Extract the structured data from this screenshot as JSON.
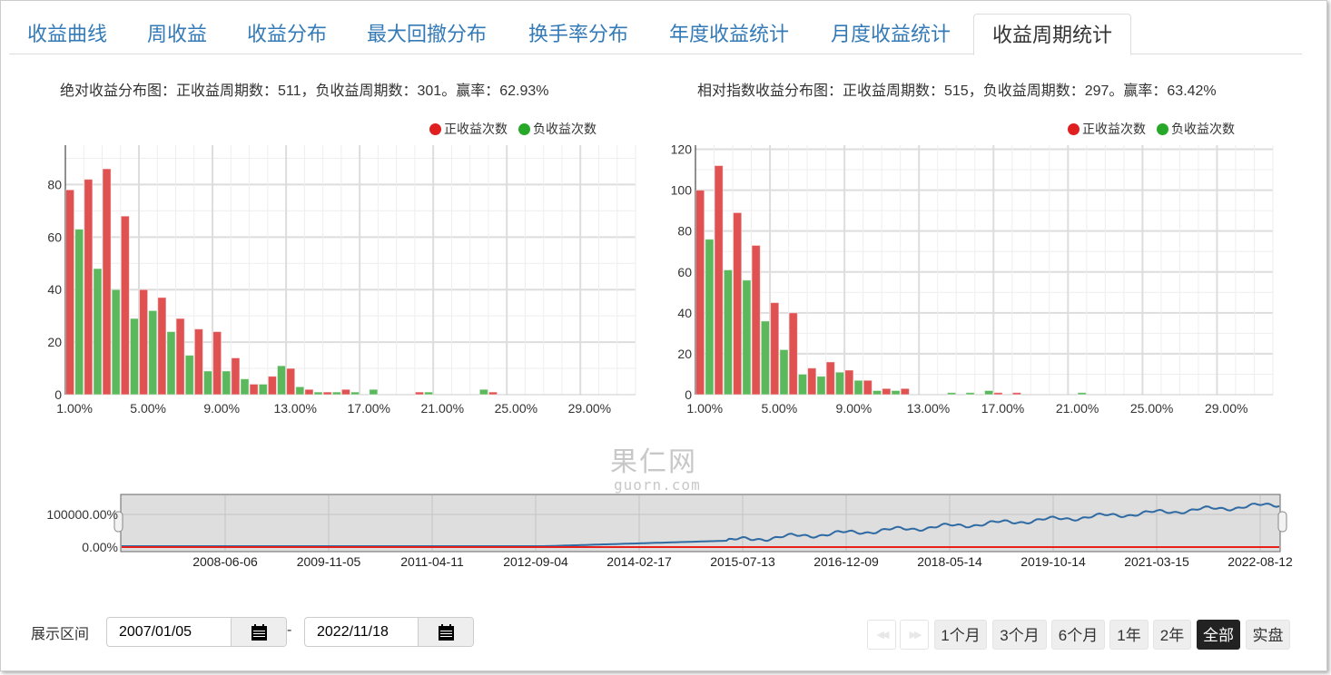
{
  "tabs": [
    {
      "label": "收益曲线"
    },
    {
      "label": "周收益"
    },
    {
      "label": "收益分布"
    },
    {
      "label": "最大回撤分布"
    },
    {
      "label": "换手率分布"
    },
    {
      "label": "年度收益统计"
    },
    {
      "label": "月度收益统计"
    },
    {
      "label": "收益周期统计",
      "active": true
    }
  ],
  "legend": {
    "positive": "正收益次数",
    "negative": "负收益次数"
  },
  "colors": {
    "positive": "#e05252",
    "negative": "#5cb85c",
    "accent": "#337ab7",
    "line_blue": "#2f6aa3",
    "line_red": "#e8201c"
  },
  "chart_data": [
    {
      "type": "bar",
      "title": "绝对收益分布图：正收益周期数：511，负收益周期数：301。赢率：62.93%",
      "categories": [
        "1.00%",
        "2.00%",
        "3.00%",
        "4.00%",
        "5.00%",
        "6.00%",
        "7.00%",
        "8.00%",
        "9.00%",
        "10.00%",
        "11.00%",
        "12.00%",
        "13.00%",
        "14.00%",
        "15.00%",
        "16.00%",
        "17.00%",
        "18.00%",
        "19.00%",
        "20.00%",
        "21.00%",
        "22.00%",
        "23.00%",
        "24.00%",
        "25.00%",
        "26.00%",
        "27.00%",
        "28.00%",
        "29.00%",
        "30.00%",
        "31.00%"
      ],
      "x_tick_labels": [
        "1.00%",
        "5.00%",
        "9.00%",
        "13.00%",
        "17.00%",
        "21.00%",
        "25.00%",
        "29.00%"
      ],
      "y_ticks": [
        0,
        20,
        40,
        60,
        80
      ],
      "ylim": [
        0,
        95
      ],
      "series": [
        {
          "name": "正收益次数",
          "values": [
            78,
            82,
            86,
            68,
            40,
            37,
            29,
            25,
            24,
            14,
            4,
            7,
            10,
            2,
            1,
            2,
            0,
            0,
            0,
            1,
            0,
            0,
            0,
            1,
            0,
            0,
            0,
            0,
            0,
            0,
            0
          ]
        },
        {
          "name": "负收益次数",
          "values": [
            63,
            48,
            40,
            29,
            32,
            24,
            15,
            9,
            9,
            6,
            4,
            11,
            3,
            1,
            1,
            1,
            2,
            0,
            0,
            1,
            0,
            0,
            2,
            0,
            0,
            0,
            0,
            0,
            0,
            0,
            0
          ]
        }
      ]
    },
    {
      "type": "bar",
      "title": "相对指数收益分布图：正收益周期数：515，负收益周期数：297。赢率：63.42%",
      "categories": [
        "1.00%",
        "2.00%",
        "3.00%",
        "4.00%",
        "5.00%",
        "6.00%",
        "7.00%",
        "8.00%",
        "9.00%",
        "10.00%",
        "11.00%",
        "12.00%",
        "13.00%",
        "14.00%",
        "15.00%",
        "16.00%",
        "17.00%",
        "18.00%",
        "19.00%",
        "20.00%",
        "21.00%",
        "22.00%",
        "23.00%",
        "24.00%",
        "25.00%",
        "26.00%",
        "27.00%",
        "28.00%",
        "29.00%",
        "30.00%",
        "31.00%"
      ],
      "x_tick_labels": [
        "1.00%",
        "5.00%",
        "9.00%",
        "13.00%",
        "17.00%",
        "21.00%",
        "25.00%",
        "29.00%"
      ],
      "y_ticks": [
        0,
        20,
        40,
        60,
        80,
        100,
        120
      ],
      "ylim": [
        0,
        122
      ],
      "series": [
        {
          "name": "正收益次数",
          "values": [
            100,
            112,
            89,
            73,
            45,
            40,
            13,
            16,
            12,
            7,
            3,
            3,
            0,
            0,
            0,
            0,
            1,
            1,
            0,
            0,
            0,
            0,
            0,
            0,
            0,
            0,
            0,
            0,
            0,
            0,
            0
          ]
        },
        {
          "name": "负收益次数",
          "values": [
            76,
            61,
            56,
            36,
            22,
            10,
            9,
            11,
            7,
            2,
            2,
            0,
            0,
            1,
            1,
            2,
            0,
            0,
            0,
            0,
            1,
            0,
            0,
            0,
            0,
            0,
            0,
            0,
            0,
            0,
            0
          ]
        }
      ]
    }
  ],
  "navigator": {
    "y_labels": [
      "100000.00%",
      "0.00%"
    ],
    "x_labels": [
      "2008-06-06",
      "2009-11-05",
      "2011-04-11",
      "2012-09-04",
      "2014-02-17",
      "2015-07-13",
      "2016-12-09",
      "2018-05-14",
      "2019-10-14",
      "2021-03-15",
      "2022-08-12"
    ]
  },
  "watermark": {
    "cn": "果仁网",
    "en": "guorn.com"
  },
  "range": {
    "label": "展示区间",
    "start": "2007/01/05",
    "end": "2022/11/18",
    "separator": "-"
  },
  "buttons": {
    "prev": "◀◀",
    "next": "▶▶",
    "items": [
      {
        "label": "1个月"
      },
      {
        "label": "3个月"
      },
      {
        "label": "6个月"
      },
      {
        "label": "1年"
      },
      {
        "label": "2年"
      },
      {
        "label": "全部",
        "selected": true
      },
      {
        "label": "实盘"
      }
    ]
  }
}
